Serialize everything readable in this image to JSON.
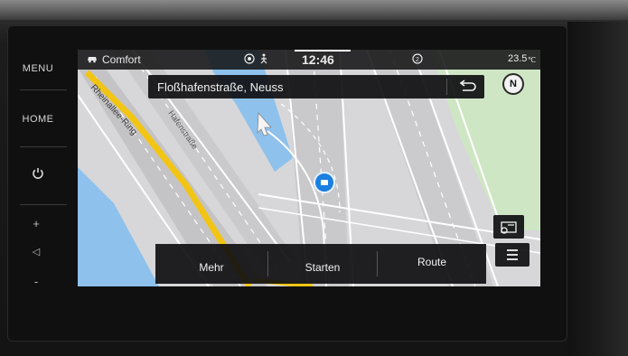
{
  "hardware": {
    "menu_label": "MENU",
    "home_label": "HOME",
    "power_icon": "power-icon",
    "vol_up": "+",
    "vol_icon": "◁",
    "vol_down": "-"
  },
  "statusbar": {
    "drive_mode": "Comfort",
    "time": "12:46",
    "temperature": "23.5",
    "temperature_unit": "℃"
  },
  "map": {
    "street_label_1": "Rheinallee-Ring",
    "street_label_2": "Hafenstraße"
  },
  "address_bar": {
    "address": "Floßhafenstraße, Neuss",
    "back_icon": "return-arrow-icon"
  },
  "compass": {
    "label": "N"
  },
  "bottom_bar": {
    "more_label": "Mehr",
    "start_label": "Starten",
    "route_label": "Route"
  },
  "colors": {
    "accent_yellow": "#f2c515",
    "water": "#8ec1ec",
    "green": "#cfe6c4",
    "position_blue": "#1b7fe0"
  }
}
